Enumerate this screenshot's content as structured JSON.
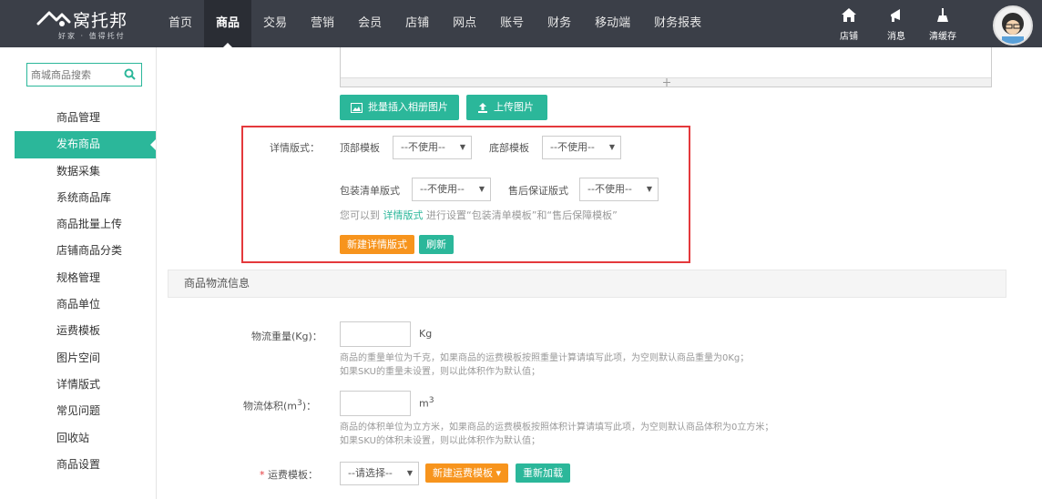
{
  "brand": {
    "name": "窝托邦",
    "slogan": "好家 · 值得托付"
  },
  "nav": [
    "首页",
    "商品",
    "交易",
    "营销",
    "会员",
    "店铺",
    "网点",
    "账号",
    "财务",
    "移动端",
    "财务报表"
  ],
  "active_nav": "商品",
  "top_right": {
    "store": "店铺",
    "messages": "消息",
    "clear_cache": "清缓存"
  },
  "sidebar": {
    "search_placeholder": "商城商品搜索",
    "items": [
      "商品管理",
      "发布商品",
      "数据采集",
      "系统商品库",
      "商品批量上传",
      "店铺商品分类",
      "规格管理",
      "商品单位",
      "运费模板",
      "图片空间",
      "详情版式",
      "常见问题",
      "回收站",
      "商品设置"
    ],
    "active": "发布商品"
  },
  "image_buttons": {
    "batch_insert": "批量插入相册图片",
    "upload": "上传图片"
  },
  "detail_format": {
    "label": "详情版式：",
    "top_template_label": "顶部模板",
    "top_template_value": "--不使用--",
    "bottom_template_label": "底部模板",
    "bottom_template_value": "--不使用--",
    "packing_label": "包装清单版式",
    "packing_value": "--不使用--",
    "aftersale_label": "售后保证版式",
    "aftersale_value": "--不使用--",
    "hint_before": "您可以到 ",
    "hint_link": "详情版式",
    "hint_after": " 进行设置“包装清单模板”和“售后保障模板”",
    "new_button": "新建详情版式",
    "refresh_button": "刷新"
  },
  "logistics": {
    "section_title": "商品物流信息",
    "weight_label": "物流重量(Kg)：",
    "weight_unit": "Kg",
    "weight_hint_1": "商品的重量单位为千克，如果商品的运费模板按照重量计算请填写此项，为空则默认商品重量为0Kg；",
    "weight_hint_2": "如果SKU的重量未设置，则以此体积作为默认值；",
    "volume_label_pre": "物流体积(m",
    "volume_label_sup": "3",
    "volume_label_post": ")：",
    "volume_unit": "m",
    "volume_unit_sup": "3",
    "volume_hint_1": "商品的体积单位为立方米，如果商品的运费模板按照体积计算请填写此项，为空则默认商品体积为0立方米；",
    "volume_hint_2": "如果SKU的体积未设置，则以此体积作为默认值；",
    "freight_required": "*",
    "freight_label": " 运费模板：",
    "freight_value": "--请选择--",
    "new_freight_button": "新建运费模板",
    "reload_button": "重新加载"
  },
  "colors": {
    "topbar": "#3b3f48",
    "accent": "#2bb79a",
    "orange": "#f7941d",
    "highlight": "#e4393c"
  }
}
